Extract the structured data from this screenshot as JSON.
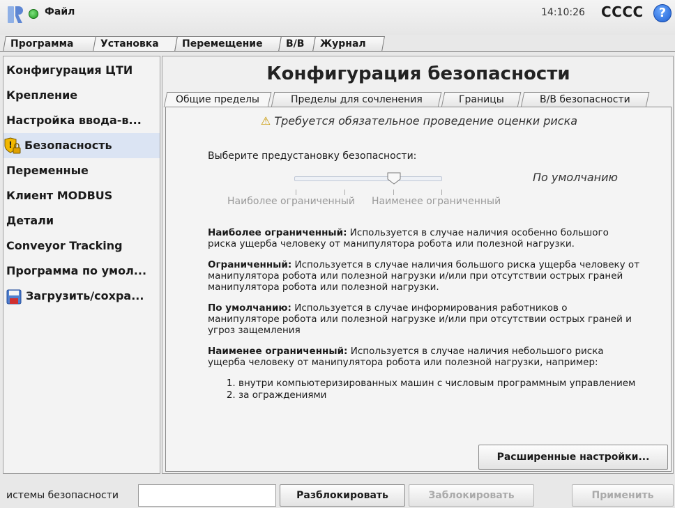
{
  "topbar": {
    "file_menu": "Файл",
    "clock": "14:10:26",
    "robot_name": "CCCC",
    "help_glyph": "?"
  },
  "main_tabs": [
    "Программа",
    "Установка",
    "Перемещение",
    "В/В",
    "Журнал"
  ],
  "main_tabs_active": "Установка",
  "sidebar": {
    "items": [
      {
        "label": "Конфигурация ЦТИ"
      },
      {
        "label": "Крепление"
      },
      {
        "label": "Настройка ввода-в..."
      },
      {
        "label": "Безопасность",
        "icon": "shield-lock-icon",
        "active": true
      },
      {
        "label": "Переменные"
      },
      {
        "label": "Клиент MODBUS"
      },
      {
        "label": "Детали"
      },
      {
        "label": "Conveyor Tracking"
      },
      {
        "label": "Программа по умол..."
      },
      {
        "label": "Загрузить/сохра...",
        "icon": "save-icon"
      }
    ]
  },
  "content": {
    "title": "Конфигурация безопасности",
    "sub_tabs": [
      "Общие пределы",
      "Пределы для сочленения",
      "Границы",
      "В/В безопасности"
    ],
    "sub_tabs_active": "Общие пределы",
    "risk_warning": "Требуется обязательное проведение оценки риска",
    "preset_label": "Выберите предустановку безопасности:",
    "preset_value": "По умолчанию",
    "slider": {
      "label_left": "Наиболее ограниченный",
      "label_right": "Наименее ограниченный",
      "positions": 4,
      "selected_index": 2
    },
    "descriptions": [
      {
        "title": "Наиболее ограниченный:",
        "text": " Используется в случае наличия особенно большого риска ущерба человеку от манипулятора робота или полезной нагрузки."
      },
      {
        "title": "Ограниченный:",
        "text": " Используется в случае наличия большого риска ущерба человеку от манипулятора робота или полезной нагрузки и/или при отсутствии острых граней манипулятора робота или полезной нагрузки."
      },
      {
        "title": "По умолчанию:",
        "text": " Используется в случае информирования работников о манипуляторе робота или полезной нагрузке и/или при отсутствии острых граней и угроз защемления"
      },
      {
        "title": "Наименее ограниченный:",
        "text": " Используется в случае наличия небольшого риска ущерба человеку от манипулятора робота или полезной нагрузки, например:"
      }
    ],
    "list_items": [
      "внутри компьютеризированных машин с числовым программным управлением",
      "за ограждениями"
    ],
    "advanced_button": "Расширенные настройки..."
  },
  "footer": {
    "password_label": "истемы безопасности",
    "password_value": "",
    "unlock_button": "Разблокировать",
    "lock_button": "Заблокировать",
    "apply_button": "Применить"
  },
  "colors": {
    "accent": "#1e5fd0",
    "status_ok": "#1e9a1e",
    "selected_row": "#dbe4f3",
    "warning": "#c99700"
  }
}
